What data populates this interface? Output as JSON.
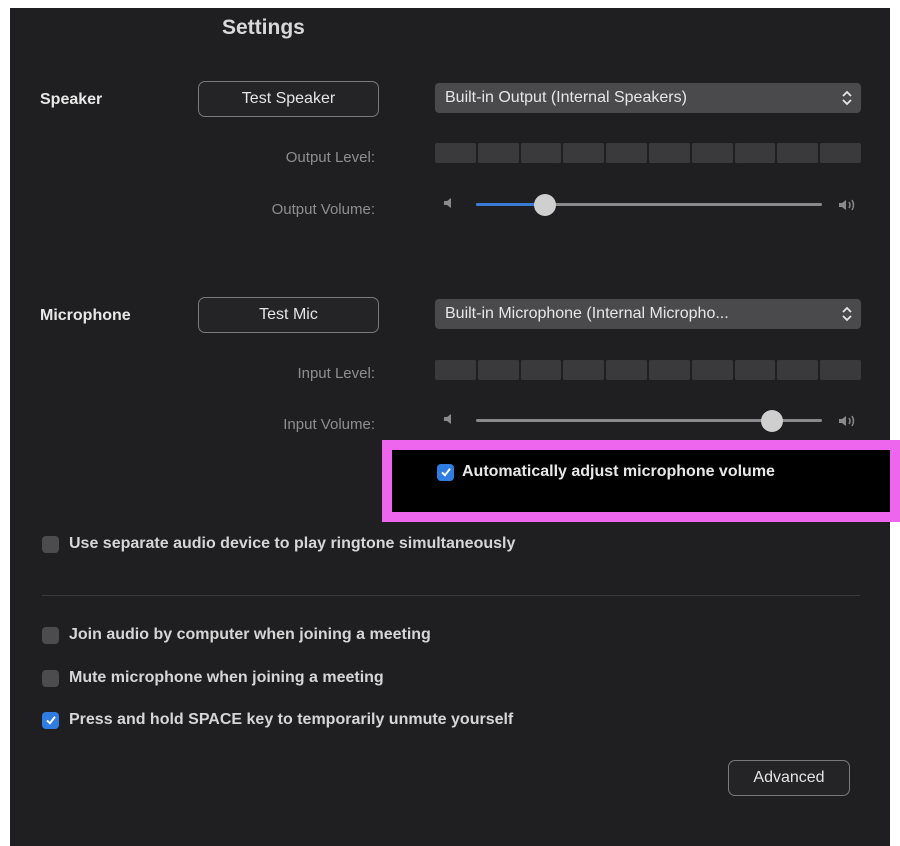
{
  "window": {
    "title": "Settings"
  },
  "speaker": {
    "label": "Speaker",
    "test_button": "Test Speaker",
    "device": "Built-in Output (Internal Speakers)",
    "output_level_label": "Output Level:",
    "output_volume_label": "Output Volume:",
    "output_volume": 0.18
  },
  "microphone": {
    "label": "Microphone",
    "test_button": "Test Mic",
    "device": "Built-in Microphone (Internal Micropho...",
    "input_level_label": "Input Level:",
    "input_volume_label": "Input Volume:",
    "input_volume": 0.88,
    "auto_adjust": {
      "label": "Automatically adjust microphone volume",
      "checked": true
    }
  },
  "options": {
    "separate_ringtone": {
      "label": "Use separate audio device to play ringtone simultaneously",
      "checked": false
    },
    "join_audio": {
      "label": "Join audio by computer when joining a meeting",
      "checked": false
    },
    "mute_on_join": {
      "label": "Mute microphone when joining a meeting",
      "checked": false
    },
    "space_unmute": {
      "label": "Press and hold SPACE key to temporarily unmute yourself",
      "checked": true
    }
  },
  "advanced_button": "Advanced",
  "colors": {
    "accent": "#2f7de1",
    "highlight": "#ee66ee",
    "background": "#1f1f21"
  }
}
